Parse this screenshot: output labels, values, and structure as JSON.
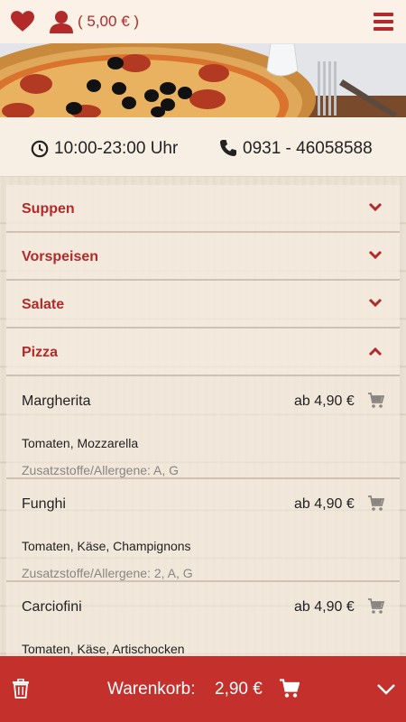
{
  "header": {
    "account_amount": "( 5,00 € )",
    "icons": [
      "heart-icon",
      "user-icon",
      "menu-icon"
    ]
  },
  "hero": {
    "image": "pizza-photo"
  },
  "info": {
    "hours": "10:00-23:00 Uhr",
    "phone": "0931 - 46058588"
  },
  "categories": [
    {
      "label": "Suppen",
      "expanded": false
    },
    {
      "label": "Vorspeisen",
      "expanded": false
    },
    {
      "label": "Salate",
      "expanded": false
    },
    {
      "label": "Pizza",
      "expanded": true
    }
  ],
  "items": [
    {
      "name": "Margherita",
      "price": "ab 4,90 €",
      "desc": "Tomaten, Mozzarella",
      "allergens": "Zusatzstoffe/Allergene: A, G"
    },
    {
      "name": "Funghi",
      "price": "ab 4,90 €",
      "desc": "Tomaten, Käse, Champignons",
      "allergens": "Zusatzstoffe/Allergene: 2, A, G"
    },
    {
      "name": "Carciofini",
      "price": "ab 4,90 €",
      "desc": "Tomaten, Käse, Artischocken",
      "allergens": ""
    }
  ],
  "cart": {
    "label": "Warenkorb:",
    "total": "2,90 €"
  },
  "colors": {
    "accent": "#b22a2a",
    "bar": "#c4302c"
  }
}
